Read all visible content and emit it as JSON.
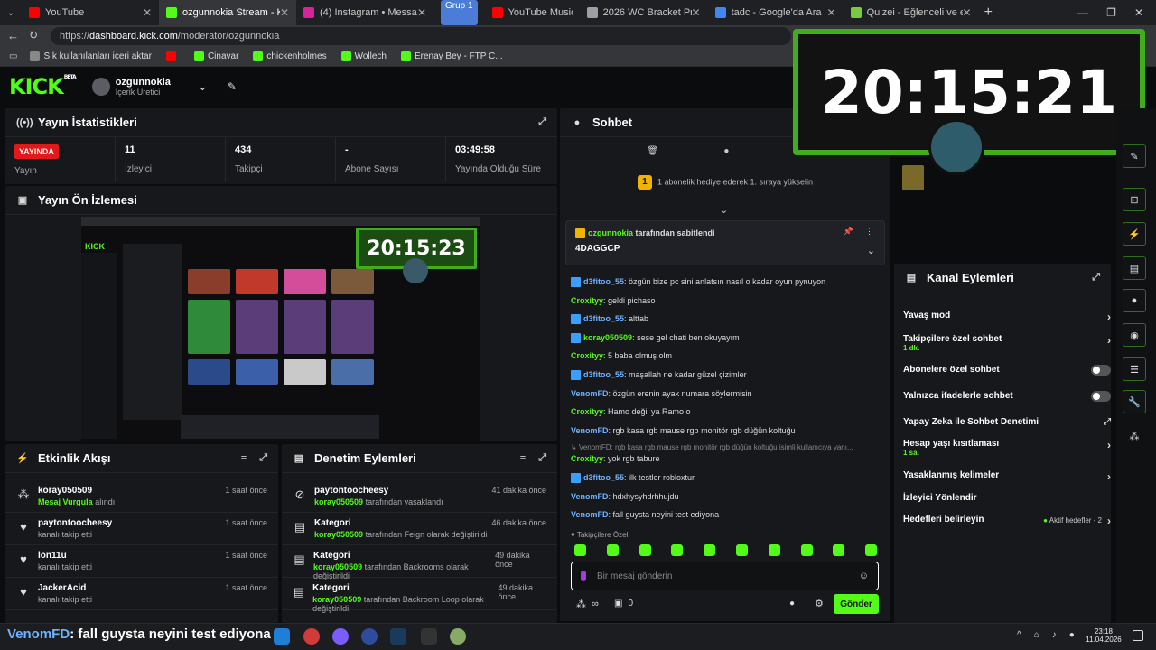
{
  "browser": {
    "tabs": [
      {
        "label": "YouTube",
        "color": "#ff0000",
        "active": false
      },
      {
        "label": "ozgunnokia Stream - Kick Dashb",
        "color": "#53fc18",
        "active": true
      },
      {
        "label": "(4) Instagram • Messages",
        "color": "#d6249f",
        "active": false
      },
      {
        "label": "YouTube Music",
        "color": "#ff0000",
        "active": false
      },
      {
        "label": "2026 WC Bracket Predictor",
        "color": "#9aa0a6",
        "active": false
      },
      {
        "label": "tadc - Google'da Ara",
        "color": "#4285f4",
        "active": false
      },
      {
        "label": "Quizei - Eğlenceli ve etkileşimli q",
        "color": "#7ac943",
        "active": false
      }
    ],
    "group_label": "Grup 1",
    "url_prefix": "https://",
    "url_host": "dashboard.kick.com",
    "url_path": "/moderator/ozgunnokia",
    "bookmarks": [
      "Sık kullanılanları içeri aktar",
      "",
      "Cinavar",
      "chickenholmes",
      "Wollech",
      "Erenay Bey - FTP C..."
    ]
  },
  "header": {
    "logo": "KICK",
    "beta": "BETA",
    "username": "ozgunnokia",
    "role": "İçerik Üretici"
  },
  "stats": {
    "title": "Yayın İstatistikleri",
    "live_badge": "YAYINDA",
    "live_label": "Yayın",
    "viewers_value": "11",
    "viewers_label": "İzleyici",
    "followers_value": "434",
    "followers_label": "Takipçi",
    "subs_value": "-",
    "subs_label": "Abone Sayısı",
    "uptime_value": "03:49:58",
    "uptime_label": "Yayında Olduğu Süre"
  },
  "preview": {
    "title": "Yayın Ön İzlemesi",
    "clock": "20:15:23"
  },
  "overlay": {
    "clock": "20:15:21"
  },
  "activity": {
    "title": "Etkinlik Akışı",
    "items": [
      {
        "user": "koray050509",
        "sub_hl": "Mesaj Vurgula",
        "sub": " alındı",
        "time": "1 saat önce"
      },
      {
        "user": "paytontoocheesy",
        "sub_hl": "",
        "sub": "kanalı takip etti",
        "time": "1 saat önce"
      },
      {
        "user": "lon11u",
        "sub_hl": "",
        "sub": "kanalı takip etti",
        "time": "1 saat önce"
      },
      {
        "user": "JackerAcid",
        "sub_hl": "",
        "sub": "kanalı takip etti",
        "time": "1 saat önce"
      }
    ]
  },
  "moderation": {
    "title": "Denetim Eylemleri",
    "items": [
      {
        "title": "paytontoocheesy",
        "sub_hl": "koray050509",
        "sub": " tarafından yasaklandı",
        "time": "41 dakika önce"
      },
      {
        "title": "Kategori",
        "sub_hl": "koray050509",
        "sub": " tarafından Feign olarak değiştirildi",
        "time": "46 dakika önce"
      },
      {
        "title": "Kategori",
        "sub_hl": "koray050509",
        "sub": " tarafından Backrooms olarak değiştirildi",
        "time": "49 dakika önce"
      },
      {
        "title": "Kategori",
        "sub_hl": "koray050509",
        "sub": " tarafından Backroom Loop olarak değiştirildi",
        "time": "49 dakika önce"
      }
    ]
  },
  "chat": {
    "title": "Sohbet",
    "gift_banner": "1 abonelik hediye ederek 1. sıraya yükselin",
    "pinned_by_user": "ozgunnokia",
    "pinned_by_text": " tarafından sabitlendi",
    "pinned_message": "4DAGGCP",
    "messages": [
      {
        "user": "d3fitoo_55",
        "text": ": özgün bize pc sini anlatsın nasıl o kadar oyun pynuyon",
        "badge": true,
        "cls": "u1"
      },
      {
        "user": "Croxityy",
        "text": ": geldi pichaso",
        "badge": false,
        "cls": "u2"
      },
      {
        "user": "d3fitoo_55",
        "text": ": alttab",
        "badge": true,
        "cls": "u1"
      },
      {
        "user": "koray050509",
        "text": ": sese gel chati ben okuyayım",
        "badge": true,
        "cls": "u2"
      },
      {
        "user": "Croxityy",
        "text": ": 5 baba olmuş olm",
        "badge": false,
        "cls": "u2"
      },
      {
        "user": "d3fitoo_55",
        "text": ": maşallah ne kadar güzel çizimler",
        "badge": true,
        "cls": "u1"
      },
      {
        "user": "VenomFD",
        "text": ": özgün erenin ayak numara söylermisin",
        "badge": false,
        "cls": "u3"
      },
      {
        "user": "Croxityy",
        "text": ": Hamo değil ya Ramo o",
        "badge": false,
        "cls": "u2"
      },
      {
        "user": "VenomFD",
        "text": ": rgb kasa rgb mause rgb monitör rgb düğün koltuğu",
        "badge": false,
        "cls": "u3"
      },
      {
        "user": "Croxityy",
        "text": ": yok rgb tabure",
        "badge": false,
        "cls": "u2"
      },
      {
        "user": "d3fitoo_55",
        "text": ": ilk testler robloxtur",
        "badge": true,
        "cls": "u1"
      },
      {
        "user": "VenomFD",
        "text": ": hdxhysyhdrhhujdu",
        "badge": false,
        "cls": "u3"
      },
      {
        "user": "VenomFD",
        "text": ": fall guysta neyini test ediyona",
        "badge": false,
        "cls": "u3"
      }
    ],
    "reply_preview": "↳ VenomFD: rgb kasa rgb mause rgb monitör rgb düğün koltuğu isimli kullanıcıya yanı...",
    "followers_only": "Takipçilere Özel",
    "input_placeholder": "Bir mesaj gönderin",
    "points": "∞",
    "zero": "0",
    "send_label": "Gönder"
  },
  "channel_actions": {
    "title": "Kanal Eylemleri",
    "items": [
      {
        "label": "Yavaş mod",
        "sub": "",
        "ctrl": "chev"
      },
      {
        "label": "Takipçilere özel sohbet",
        "sub": "1 dk.",
        "ctrl": "chev"
      },
      {
        "label": "Abonelere özel sohbet",
        "sub": "",
        "ctrl": "toggle"
      },
      {
        "label": "Yalnızca ifadelerle sohbet",
        "sub": "",
        "ctrl": "toggle"
      },
      {
        "label": "Yapay Zeka ile Sohbet Denetimi",
        "sub": "",
        "ctrl": "ext"
      },
      {
        "label": "Hesap yaşı kısıtlaması",
        "sub": "1 sa.",
        "ctrl": "chev"
      },
      {
        "label": "Yasaklanmış kelimeler",
        "sub": "",
        "ctrl": "chev"
      },
      {
        "label": "İzleyici Yönlendir",
        "sub": "",
        "ctrl": "none"
      },
      {
        "label": "Hedefleri belirleyin",
        "sub": "",
        "ctrl": "chev"
      }
    ],
    "goals_status": "Aktif hedefler - 2"
  },
  "taskbar": {
    "overlay_user": "VenomFD",
    "overlay_text": "fall guysta neyini test ediyona",
    "time": "23:18",
    "date": "11.04.2026"
  },
  "colors": {
    "accent": "#53fc18",
    "live": "#e01a1a",
    "panel": "#17181b"
  }
}
